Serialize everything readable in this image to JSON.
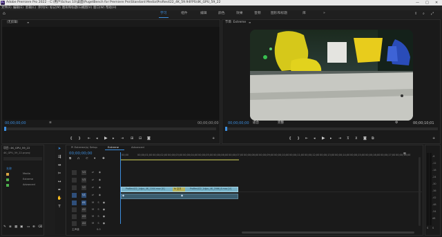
{
  "titlebar": {
    "app_icon": "Pr",
    "title": "Adobe Premiere Pro 2022 - C:\\用户\\Schus 10\\桌面\\PugetBench for Premiere Pro\\Standard Media\\ProRes422_4K_59.94FPS\\4K_GPU_59_22",
    "minimize": "—",
    "maximize": "□",
    "close": "✕"
  },
  "menu": [
    "文件(F)",
    "编辑(E)",
    "剪辑(C)",
    "序列(S)",
    "标记(M)",
    "图形和标题(G)",
    "视图(V)",
    "窗口(W)",
    "帮助(H)"
  ],
  "workspace": {
    "home": "⌂",
    "tabs": [
      "学习",
      "组件",
      "编辑",
      "颜色",
      "效果",
      "音频",
      "图形和标题",
      "库"
    ],
    "active_index": 0,
    "more": "»"
  },
  "source": {
    "title": "（无剪辑）",
    "tc_left": "00;00;00;00",
    "fit": "≡",
    "tc_right": "00;00;00;00"
  },
  "program": {
    "title": "节目: Extreme",
    "tc_left": "00;00;00;00",
    "fit": "适合",
    "quality": "完整",
    "tc_right": "00;00;10;01"
  },
  "project": {
    "title": "项目: 4K_GPU_59_22",
    "file": "4K_GPU_59_22.prproj",
    "column": "名称",
    "items": [
      {
        "name": "Media",
        "color": "#d9a441"
      },
      {
        "name": "Extreme",
        "color": "#4db34d"
      },
      {
        "name": "Advanced",
        "color": "#4db34d"
      }
    ]
  },
  "timeline": {
    "tabs": [
      "PI Extreme(s) Setup",
      "Extreme",
      "Advanced"
    ],
    "active_tab": 1,
    "timecode": "00;00;00;00",
    "ruler": [
      "00;00",
      "00;00;01;00",
      "00;00;02;00",
      "00;00;03;00",
      "00;00;04;00",
      "00;00;05;00",
      "00;00;06;00",
      "00;00;07;00",
      "00;00;08;00",
      "00;00;09;00",
      "00;00;10;00",
      "00;00;11;00",
      "00;00;12;00",
      "00;00;13;00",
      "00;00;14;00",
      "00;00;15;00",
      "00;00;16;00",
      "00;00;17;00",
      "00;00;18;00",
      "00;00;19;00",
      "00;00;20;00"
    ],
    "video_tracks": [
      "V4",
      "V3",
      "V2",
      "V1"
    ],
    "audio_tracks": [
      "A1",
      "A2",
      "A3",
      "A4"
    ],
    "clip_v1a": "ProRes422_1djpu_4K_1044.mov [V]",
    "clip_fx": "fx 交叉",
    "clip_v1b": "ProRes422_1djpu_4K_2066_6.mov [V]",
    "master_label": "主声道",
    "master_value": "0.0"
  },
  "meters": {
    "ticks": [
      "-6",
      "-12",
      "-18",
      "-24",
      "-30",
      "-36",
      "-42",
      "-48",
      "-54",
      "dB"
    ],
    "bottom": [
      "S",
      "S"
    ]
  },
  "colors": {
    "accent": "#3d8fe0",
    "clip": "#77b3c9",
    "clip_fx": "#b8b35a"
  }
}
